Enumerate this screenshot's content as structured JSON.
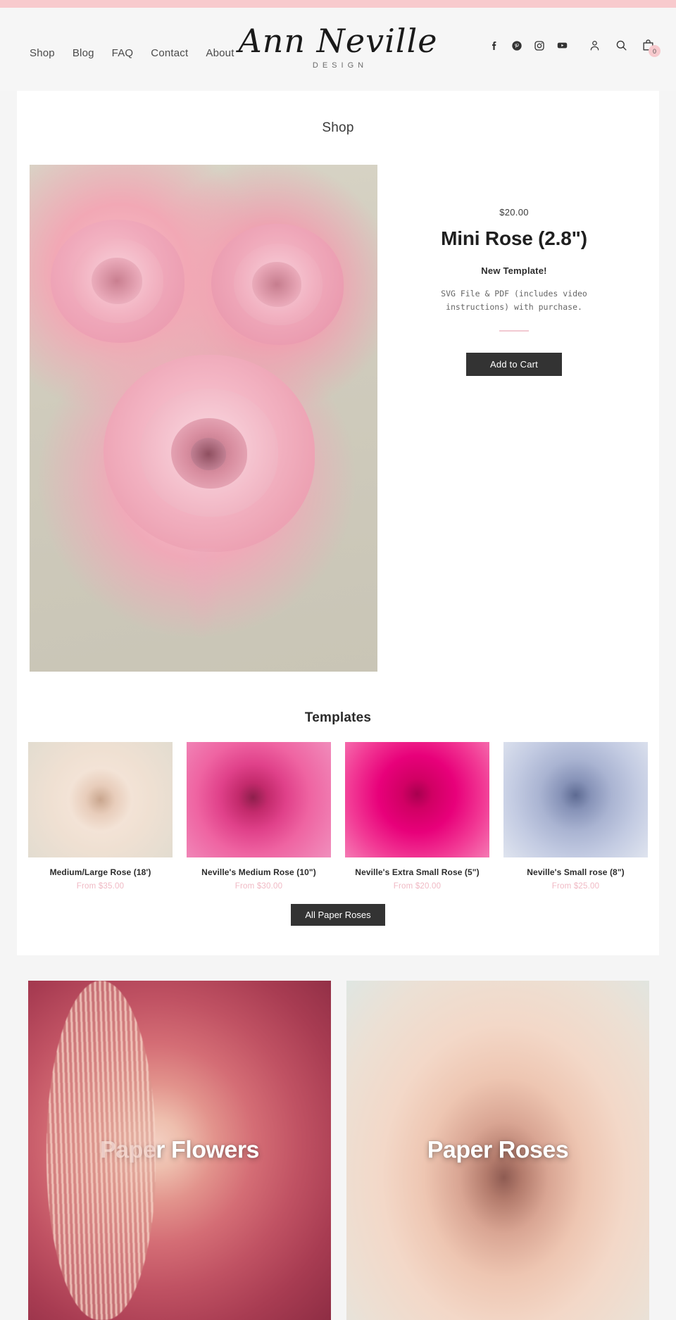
{
  "theme": {
    "top_stripe_color": "#f8cacd",
    "page_bg": "#f5f5f5",
    "header_bg": "#f6f6f6",
    "accent_pink": "#f0b9c4",
    "button_dark": "#333333"
  },
  "header": {
    "nav": [
      {
        "label": "Shop"
      },
      {
        "label": "Blog"
      },
      {
        "label": "FAQ"
      },
      {
        "label": "Contact"
      },
      {
        "label": "About"
      }
    ],
    "logo": {
      "script": "Ann Neville",
      "subtitle": "DESIGN"
    },
    "social": [
      {
        "icon": "facebook-icon",
        "label": "Facebook"
      },
      {
        "icon": "pinterest-icon",
        "label": "Pinterest"
      },
      {
        "icon": "instagram-icon",
        "label": "Instagram"
      },
      {
        "icon": "youtube-icon",
        "label": "YouTube"
      }
    ],
    "utilities": [
      {
        "icon": "account-icon",
        "label": "Account"
      },
      {
        "icon": "search-icon",
        "label": "Search"
      },
      {
        "icon": "cart-icon",
        "label": "Cart"
      }
    ],
    "cart_count": "0"
  },
  "main": {
    "page_title": "Shop"
  },
  "product": {
    "image_alt": "three pink paper mini roses on neutral background",
    "price": "$20.00",
    "title": "Mini Rose (2.8\")",
    "badge": "New Template!",
    "description": "SVG File & PDF (includes video instructions) with purchase.",
    "add_to_cart_label": "Add to Cart"
  },
  "templates": {
    "heading": "Templates",
    "items": [
      {
        "name": "Medium/Large Rose (18')",
        "price": "From $35.00",
        "thumb_class": "t1",
        "image_alt": "cream blush paper rose"
      },
      {
        "name": "Neville's Medium Rose (10\")",
        "price": "From $30.00",
        "thumb_class": "t2",
        "image_alt": "magenta paper roses"
      },
      {
        "name": "Neville's Extra Small Rose (5\")",
        "price": "From $20.00",
        "thumb_class": "t3",
        "image_alt": "hot pink paper rose"
      },
      {
        "name": "Neville's Small rose (8\")",
        "price": "From $25.00",
        "thumb_class": "t4",
        "image_alt": "periwinkle blue paper rose"
      }
    ],
    "all_button_label": "All Paper Roses"
  },
  "banners": [
    {
      "label": "Paper Flowers",
      "class": "banner-flowers",
      "image_alt": "large rose and blush paper flower close-up"
    },
    {
      "label": "Paper Roses",
      "class": "banner-roses",
      "image_alt": "blush cream paper rose close-up"
    }
  ]
}
